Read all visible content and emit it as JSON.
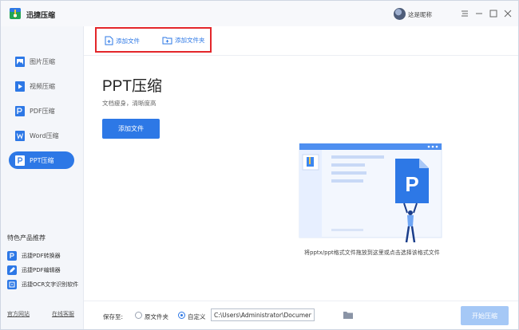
{
  "app": {
    "name": "迅捷压缩",
    "user_name": "这是昵称",
    "accent_color": "#2d78e6"
  },
  "window_controls": [
    "menu-icon",
    "minimize-icon",
    "maximize-icon",
    "close-icon"
  ],
  "toolbar": {
    "add_file_label": "添加文件",
    "add_folder_label": "添加文件夹"
  },
  "sidebar": {
    "items": [
      {
        "label": "图片压缩",
        "icon": "image-icon"
      },
      {
        "label": "视频压缩",
        "icon": "video-icon"
      },
      {
        "label": "PDF压缩",
        "icon": "pdf-icon"
      },
      {
        "label": "Word压缩",
        "icon": "word-icon"
      },
      {
        "label": "PPT压缩",
        "icon": "ppt-icon",
        "active": true
      }
    ],
    "promo_title": "特色产品推荐",
    "promos": [
      {
        "label": "迅捷PDF转换器",
        "icon": "pdf-converter-icon"
      },
      {
        "label": "迅捷PDF编辑器",
        "icon": "pdf-editor-icon"
      },
      {
        "label": "迅捷OCR文字识别软件",
        "icon": "ocr-icon"
      }
    ],
    "footer_links": [
      "官方网站",
      "在线客服"
    ]
  },
  "main": {
    "title": "PPT压缩",
    "subtitle": "文档瘦身，清晰度高",
    "add_file_button": "添加文件",
    "illustration_letter": "P",
    "drop_hint": "将pptx/ppt格式文件拖放到这里或点击选择该格式文件"
  },
  "bottom": {
    "save_label": "保存至:",
    "option_original": "原文件夹",
    "option_custom": "自定义",
    "selected_option": "自定义",
    "path_value": "C:\\Users\\Administrator\\Documents",
    "start_button": "开始压缩"
  }
}
